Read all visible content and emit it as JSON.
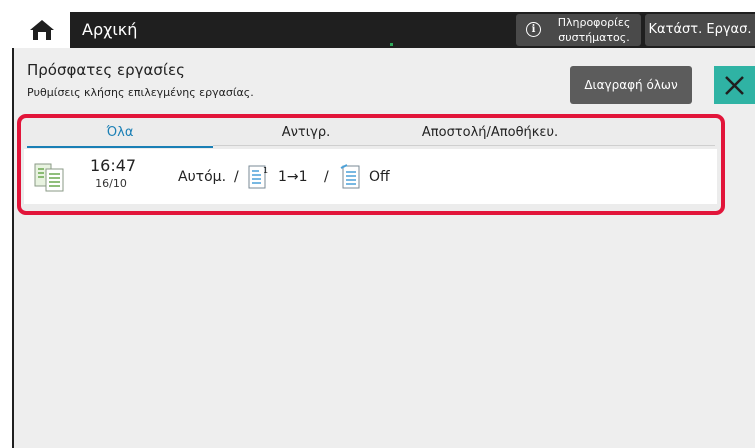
{
  "header": {
    "home_icon": "home-icon",
    "title": "Αρχική",
    "info_button": "Πληροφορίες συστήματος.",
    "info_icon": "info-icon",
    "status_button": "Κατάστ. Εργασ."
  },
  "page": {
    "title": "Πρόσφατες εργασίες",
    "subtitle": "Ρυθμίσεις κλήσης επιλεγμένης εργασίας.",
    "delete_all_button": "Διαγραφή όλων",
    "close_icon": "close-icon"
  },
  "tabs": [
    {
      "label": "Όλα",
      "selected": true
    },
    {
      "label": "Αντιγρ.",
      "selected": false
    },
    {
      "label": "Αποστολή/Αποθήκευ.",
      "selected": false
    }
  ],
  "jobs": [
    {
      "icon": "copy-job-icon",
      "time": "16:47",
      "date": "16/10",
      "mode": "Αυτόμ.",
      "duplex_icon": "duplex-icon",
      "duplex": "1→1",
      "staple_icon": "staple-icon",
      "staple": "Off"
    }
  ],
  "colors": {
    "accent_blue": "#1a7fb5",
    "highlight_red": "#e2153a",
    "close_teal": "#2fb3a4",
    "topbar": "#1f1f1f"
  }
}
